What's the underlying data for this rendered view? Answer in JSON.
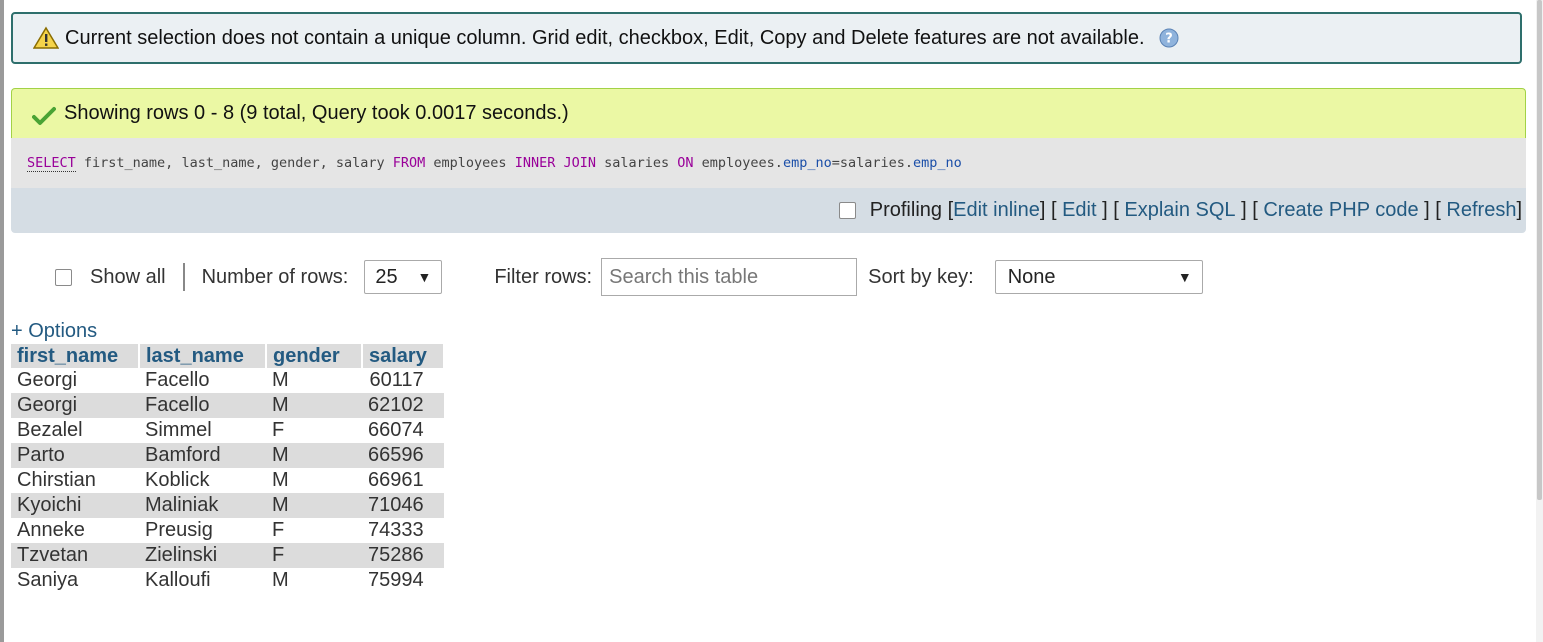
{
  "notice": {
    "text": "Current selection does not contain a unique column. Grid edit, checkbox, Edit, Copy and Delete features are not available.",
    "icon": "warning-icon",
    "help_icon": "help-icon"
  },
  "success": {
    "text": "Showing rows 0 - 8 (9 total, Query took 0.0017 seconds.)",
    "icon": "check-icon"
  },
  "sql": {
    "select_kw": "SELECT",
    "columns_text": " first_name, last_name, gender, salary ",
    "from_kw": "FROM",
    "table1": " employees ",
    "inner_kw": "INNER",
    "join_kw": "JOIN",
    "table2": " salaries ",
    "on_kw": "ON",
    "left_table": " employees.",
    "left_col": "emp_no",
    "eq_table": "=salaries.",
    "right_col": "emp_no"
  },
  "actions": {
    "profiling": "Profiling",
    "edit_inline": "Edit inline",
    "edit": "Edit",
    "explain": "Explain SQL",
    "create_php": "Create PHP code",
    "refresh": "Refresh"
  },
  "nav": {
    "show_all": "Show all",
    "rows_label": "Number of rows:",
    "rows_value": "25",
    "filter_label": "Filter rows:",
    "filter_placeholder": "Search this table",
    "sort_label": "Sort by key:",
    "sort_value": "None"
  },
  "options_link": "+ Options",
  "table": {
    "headers": [
      "first_name",
      "last_name",
      "gender",
      "salary"
    ],
    "rows": [
      [
        "Georgi",
        "Facello",
        "M",
        "60117"
      ],
      [
        "Georgi",
        "Facello",
        "M",
        "62102"
      ],
      [
        "Bezalel",
        "Simmel",
        "F",
        "66074"
      ],
      [
        "Parto",
        "Bamford",
        "M",
        "66596"
      ],
      [
        "Chirstian",
        "Koblick",
        "M",
        "66961"
      ],
      [
        "Kyoichi",
        "Maliniak",
        "M",
        "71046"
      ],
      [
        "Anneke",
        "Preusig",
        "F",
        "74333"
      ],
      [
        "Tzvetan",
        "Zielinski",
        "F",
        "75286"
      ],
      [
        "Saniya",
        "Kalloufi",
        "M",
        "75994"
      ]
    ]
  }
}
